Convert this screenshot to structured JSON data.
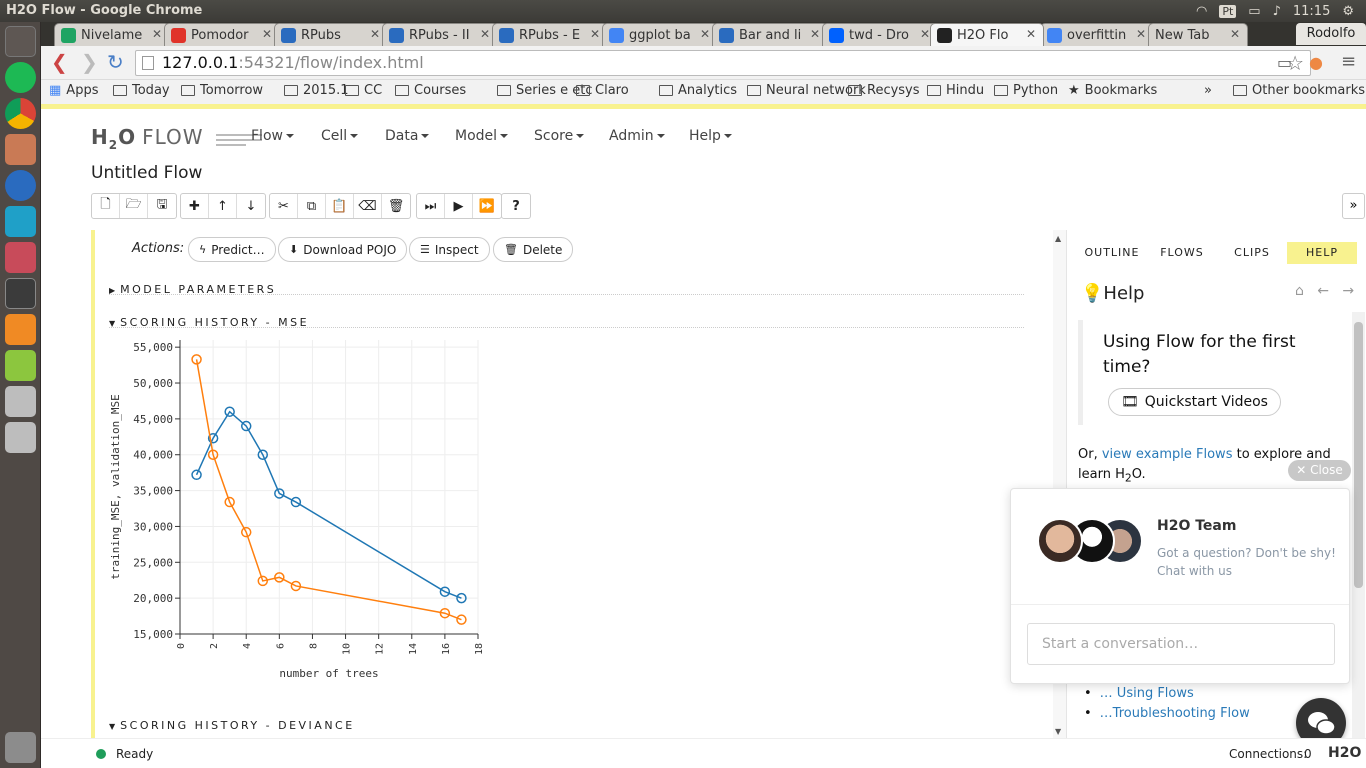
{
  "window": {
    "title": "H2O Flow - Google Chrome",
    "time": "11:15",
    "user": "Rodolfo",
    "keyboard": "Pt"
  },
  "tabs": [
    {
      "label": "Nivelame",
      "icon": "google-drive-icon",
      "color": "#1fa463",
      "active": false
    },
    {
      "label": "Pomodor",
      "icon": "tomato-icon",
      "color": "#e0332a",
      "active": false
    },
    {
      "label": "RPubs",
      "icon": "r-icon",
      "color": "#2a6bbf",
      "active": false
    },
    {
      "label": "RPubs - II",
      "icon": "r-icon",
      "color": "#2a6bbf",
      "active": false
    },
    {
      "label": "RPubs - E",
      "icon": "r-icon",
      "color": "#2a6bbf",
      "active": false
    },
    {
      "label": "ggplot ba",
      "icon": "google-icon",
      "color": "#4285f4",
      "active": false
    },
    {
      "label": "Bar and li",
      "icon": "r-icon",
      "color": "#2a6bbf",
      "active": false
    },
    {
      "label": "twd - Dro",
      "icon": "dropbox-icon",
      "color": "#0061fe",
      "active": false
    },
    {
      "label": "H2O Flo",
      "icon": "h2o-icon",
      "color": "#222222",
      "active": true
    },
    {
      "label": "overfittin",
      "icon": "google-icon",
      "color": "#4285f4",
      "active": false
    },
    {
      "label": "New Tab",
      "icon": "",
      "color": "",
      "active": false
    }
  ],
  "address": {
    "host": "127.0.0.1",
    "rest": ":54321/flow/index.html"
  },
  "bookmarks": {
    "apps": "Apps",
    "folders": [
      "Today",
      "Tomorrow",
      "2015.1",
      "CC",
      "Courses",
      "Series e etc",
      "Claro",
      "Analytics",
      "Neural network",
      "Recysys",
      "Hindu",
      "Python"
    ],
    "star_item": "Bookmarks",
    "overflow": "»",
    "other": "Other bookmarks"
  },
  "h2o": {
    "logo": "H",
    "logo_sub": "2",
    "logo_o": "O",
    "logo_flow": "FLOW",
    "menus": [
      "Flow",
      "Cell",
      "Data",
      "Model",
      "Score",
      "Admin",
      "Help"
    ]
  },
  "flow_title": "Untitled Flow",
  "actions": {
    "label": "Actions:",
    "buttons": [
      {
        "label": "Predict…",
        "icon": "bolt-icon"
      },
      {
        "label": "Download POJO",
        "icon": "download-icon"
      },
      {
        "label": "Inspect",
        "icon": "list-icon"
      },
      {
        "label": "Delete",
        "icon": "trash-icon"
      }
    ]
  },
  "sections": {
    "model_parameters": "MODEL PARAMETERS",
    "scoring_mse": "SCORING HISTORY - MSE",
    "scoring_deviance": "SCORING HISTORY - DEVIANCE"
  },
  "chart_data": {
    "type": "line",
    "xlabel": "number of trees",
    "ylabel": "training_MSE, validation_MSE",
    "xlim": [
      0,
      18
    ],
    "ylim": [
      15000,
      56000
    ],
    "x_ticks": [
      0,
      2,
      4,
      6,
      8,
      10,
      12,
      14,
      16,
      18
    ],
    "y_ticks": [
      15000,
      20000,
      25000,
      30000,
      35000,
      40000,
      45000,
      50000,
      55000
    ],
    "y_tick_labels": [
      "15,000",
      "20,000",
      "25,000",
      "30,000",
      "35,000",
      "40,000",
      "45,000",
      "50,000",
      "55,000"
    ],
    "grid": true,
    "series": [
      {
        "color": "#1f77b4",
        "x": [
          1,
          2,
          3,
          4,
          5,
          6,
          7,
          16,
          17
        ],
        "y": [
          37200,
          42300,
          46000,
          44000,
          40000,
          34600,
          33400,
          20900,
          20000
        ]
      },
      {
        "color": "#ff7f0e",
        "x": [
          1,
          2,
          3,
          4,
          5,
          6,
          7,
          16,
          17
        ],
        "y": [
          53300,
          40000,
          33400,
          29200,
          22400,
          22900,
          21700,
          17900,
          17000
        ]
      }
    ]
  },
  "sidebar": {
    "tabs": [
      "OUTLINE",
      "FLOWS",
      "CLIPS",
      "HELP"
    ],
    "active_tab": "HELP",
    "help_title": "Help",
    "intro": "Using Flow for the first time?",
    "quickstart": "Quickstart Videos",
    "or_text": "Or,",
    "example_link": "view example Flows",
    "explore_text": "to explore and learn H",
    "explore_sub": "2",
    "explore_end": "O.",
    "links": [
      "… Using Flows",
      "…Troubleshooting Flow"
    ],
    "close": "Close"
  },
  "chat": {
    "team": "H2O Team",
    "message": "Got a question? Don't be shy! Chat with us",
    "placeholder": "Start a conversation…"
  },
  "status": {
    "text": "Ready",
    "connections_label": "Connections:",
    "connections_value": "0",
    "logo": "H2O"
  }
}
